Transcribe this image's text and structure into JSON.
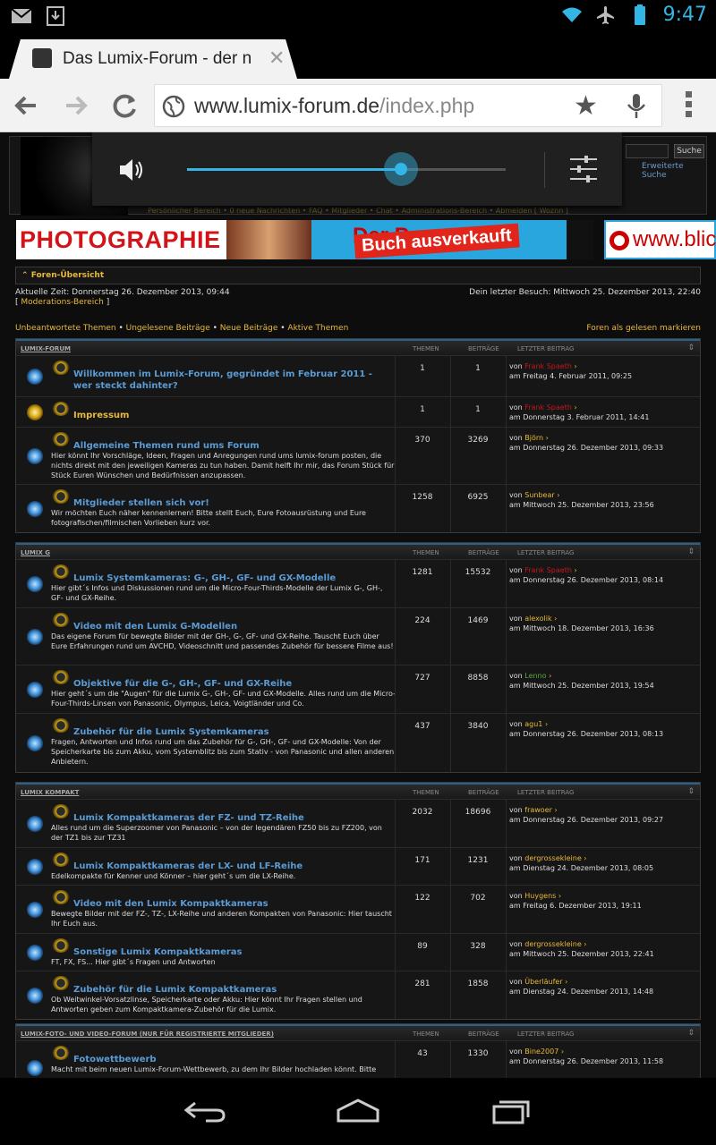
{
  "status_bar": {
    "time": "9:47"
  },
  "browser": {
    "tab_title": "Das Lumix-Forum - der n",
    "url_domain": "www.lumix-forum.de",
    "url_path": "/index.php"
  },
  "volume": {
    "level": 0.67
  },
  "header": {
    "search_button": "Suche",
    "advanced_search": "Erweiterte Suche",
    "nav": "Persönlicher Bereich • 0 neue Nachrichten • FAQ • Mitglieder • Chat • Administrations-Bereich • Abmelden [ Woznn ]"
  },
  "banner": {
    "left_text": "PHOTOGRAPHIE",
    "middle_text": "Der P",
    "overlay_text": "Buch ausverkauft",
    "right_text": "www.blic"
  },
  "page": {
    "crumb": "Foren-Übersicht",
    "current_time": "Aktuelle Zeit: Donnerstag 26. Dezember 2013, 09:44",
    "mod_area": "Moderations-Bereich",
    "last_visit": "Dein letzter Besuch: Mittwoch 25. Dezember 2013, 22:40",
    "quick": [
      "Unbeantwortete Themen",
      "Ungelesene Beiträge",
      "Neue Beiträge",
      "Aktive Themen"
    ],
    "mark_read": "Foren als gelesen markieren",
    "col_topics": "THEMEN",
    "col_posts": "BEITRÄGE",
    "col_last": "LETZTER BEITRAG"
  },
  "categories": [
    {
      "name": "LUMIX-FORUM",
      "forums": [
        {
          "title": "Willkommen im Lumix-Forum, gegründet im Februar 2011 - wer steckt dahinter?",
          "desc": "",
          "topics": "1",
          "posts": "1",
          "by": "Frank Spaeth",
          "by_color": "red",
          "date": "am Freitag 4. Februar 2011, 09:25"
        },
        {
          "title": "Impressum",
          "desc": "",
          "topics": "1",
          "posts": "1",
          "by": "Frank Spaeth",
          "by_color": "red",
          "date": "am Donnerstag 3. Februar 2011, 14:41"
        },
        {
          "title": "Allgemeine Themen rund ums Forum",
          "desc": "Hier könnt Ihr Vorschläge, Ideen, Fragen und Anregungen rund ums lumix-forum posten, die nichts direkt mit den jeweiligen Kameras zu tun haben. Damit helft Ihr mir, das Forum Stück für Stück Euren Wünschen und Bedürfnissen anzupassen.",
          "topics": "370",
          "posts": "3269",
          "by": "Björn",
          "by_color": "gold",
          "date": "am Donnerstag 26. Dezember 2013, 09:33"
        },
        {
          "title": "Mitglieder stellen sich vor!",
          "desc": "Wir möchten Euch näher kennenlernen! Bitte stellt Euch, Eure Fotoausrüstung und Eure fotografischen/filmischen Vorlieben kurz vor.",
          "topics": "1258",
          "posts": "6925",
          "by": "Sunbear",
          "by_color": "gold",
          "date": "am Mittwoch 25. Dezember 2013, 23:56"
        }
      ]
    },
    {
      "name": "LUMIX G",
      "forums": [
        {
          "title": "Lumix Systemkameras: G-, GH-, GF- und GX-Modelle",
          "desc": "Hier gibt´s Infos und Diskussionen rund um die Micro-Four-Thirds-Modelle der Lumix G-, GH-, GF- und GX-Reihe.",
          "topics": "1281",
          "posts": "15532",
          "by": "Frank Spaeth",
          "by_color": "red",
          "date": "am Donnerstag 26. Dezember 2013, 08:14"
        },
        {
          "title": "Video mit den Lumix G-Modellen",
          "desc": "Das eigene Forum für bewegte Bilder mit der GH-, G-, GF- und GX-Reihe. Tauscht Euch über Eure Erfahrungen rund um AVCHD, Videoschnitt und passendes Zubehör für bessere Filme aus!",
          "topics": "224",
          "posts": "1469",
          "by": "alexolik",
          "by_color": "gold",
          "date": "am Mittwoch 18. Dezember 2013, 16:36"
        },
        {
          "title": "Objektive für die G-, GH-, GF- und GX-Reihe",
          "desc": "Hier geht´s um die \"Augen\" für die Lumix G-, GH-, GF- und GX-Modelle. Alles rund um die Micro-Four-Thirds-Linsen von Panasonic, Olympus, Leica, Voigtländer und Co.",
          "topics": "727",
          "posts": "8858",
          "by": "Lenno",
          "by_color": "green",
          "date": "am Mittwoch 25. Dezember 2013, 19:54"
        },
        {
          "title": "Zubehör für die Lumix Systemkameras",
          "desc": "Fragen, Antworten und Infos rund um das Zubehör für G-, GH-, GF- und GX-Modelle: Von der Speicherkarte bis zum Akku, vom Systemblitz bis zum Stativ - von Panasonic und allen anderen Anbietern.",
          "topics": "437",
          "posts": "3840",
          "by": "agu1",
          "by_color": "gold",
          "date": "am Donnerstag 26. Dezember 2013, 08:13"
        }
      ]
    },
    {
      "name": "LUMIX KOMPAKT",
      "forums": [
        {
          "title": "Lumix Kompaktkameras der FZ- und TZ-Reihe",
          "desc": "Alles rund um die Superzoomer von Panasonic – von der legendären FZ50 bis zu FZ200, von der TZ1 bis zur TZ31",
          "topics": "2032",
          "posts": "18696",
          "by": "frawoer",
          "by_color": "gold",
          "date": "am Donnerstag 26. Dezember 2013, 09:27"
        },
        {
          "title": "Lumix Kompaktkameras der LX- und LF-Reihe",
          "desc": "Edelkompakte für Kenner und Könner – hier geht´s um die LX-Reihe.",
          "topics": "171",
          "posts": "1231",
          "by": "dergrossekleine",
          "by_color": "gold",
          "date": "am Dienstag 24. Dezember 2013, 08:05"
        },
        {
          "title": "Video mit den Lumix Kompaktkameras",
          "desc": "Bewegte Bilder mit der FZ-, TZ-, LX-Reihe und anderen Kompakten von Panasonic: Hier tauscht Ihr Euch aus.",
          "topics": "122",
          "posts": "702",
          "by": "Huygens",
          "by_color": "gold",
          "date": "am Freitag 6. Dezember 2013, 19:11"
        },
        {
          "title": "Sonstige Lumix Kompaktkameras",
          "desc": "FT, FX, FS... Hier gibt´s Fragen und Antworten",
          "topics": "89",
          "posts": "328",
          "by": "dergrossekleine",
          "by_color": "gold",
          "date": "am Mittwoch 25. Dezember 2013, 22:41"
        },
        {
          "title": "Zubehör für die Lumix Kompaktkameras",
          "desc": "Ob Weitwinkel-Vorsatzlinse, Speicherkarte oder Akku: Hier könnt Ihr Fragen stellen und Antworten geben zum Kompaktkamera-Zubehör für die Lumix.",
          "topics": "281",
          "posts": "1858",
          "by": "Überläufer",
          "by_color": "gold",
          "date": "am Dienstag 24. Dezember 2013, 14:48"
        }
      ]
    },
    {
      "name": "LUMIX-FOTO- UND VIDEO-FORUM (NUR FÜR REGISTRIERTE MITGLIEDER)",
      "forums": [
        {
          "title": "Fotowettbewerb",
          "desc": "Macht mit beim neuen Lumix-Forum-Wettbewerb, zu dem Ihr Bilder hochladen könnt. Bitte",
          "topics": "43",
          "posts": "1330",
          "by": "Bine2007",
          "by_color": "gold",
          "date": "am Donnerstag 26. Dezember 2013, 11:58"
        }
      ]
    }
  ]
}
